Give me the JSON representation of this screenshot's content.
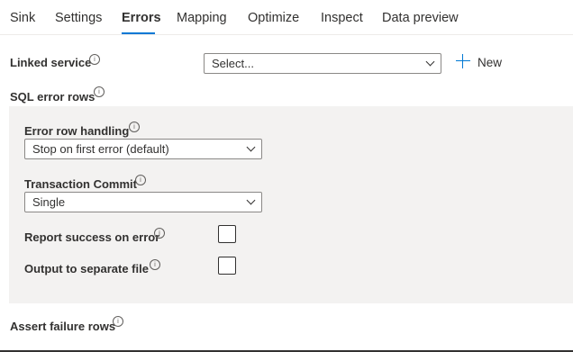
{
  "tabs": [
    {
      "label": "Sink"
    },
    {
      "label": "Settings"
    },
    {
      "label": "Errors"
    },
    {
      "label": "Mapping"
    },
    {
      "label": "Optimize"
    },
    {
      "label": "Inspect"
    },
    {
      "label": "Data preview"
    }
  ],
  "active_tab": "Errors",
  "info_glyph": "i",
  "linked_service": {
    "label": "Linked service",
    "value": "Select...",
    "new_label": "New"
  },
  "sql_error_rows": {
    "heading": "SQL error rows",
    "error_row_handling": {
      "label": "Error row handling",
      "value": "Stop on first error (default)"
    },
    "transaction_commit": {
      "label": "Transaction Commit",
      "value": "Single"
    },
    "report_success": {
      "label": "Report success on error",
      "checked": false
    },
    "output_separate": {
      "label": "Output to separate file",
      "checked": false
    }
  },
  "assert_failure_rows": {
    "heading": "Assert failure rows"
  },
  "colors": {
    "accent": "#0078d4",
    "panel": "#f3f2f1",
    "text": "#323130"
  }
}
